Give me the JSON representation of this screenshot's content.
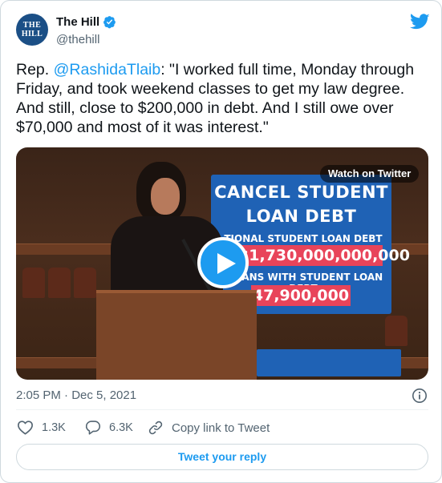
{
  "author": {
    "display_name": "The Hill",
    "handle": "@thehill",
    "verified": true,
    "avatar_text_line1": "THE",
    "avatar_text_line2": "HILL",
    "avatar_color": "#1b4f86"
  },
  "tweet": {
    "text_prefix": "Rep. ",
    "mention": "@RashidaTlaib",
    "text_body": ": \"I worked full time, Monday through Friday, and took weekend classes to get my law degree. And still, close to $200,000 in debt. And I still owe over $70,000 and most of it was interest.\"",
    "timestamp": "2:05 PM · Dec 5, 2021"
  },
  "media": {
    "watch_label": "Watch on Twitter",
    "sign_headline_1": "CANCEL STUDENT",
    "sign_headline_2": "LOAN DEBT",
    "sign_label_1": "TIONAL STUDENT LOAN DEBT",
    "sign_value_1": "$1,730,000,000,000",
    "sign_label_2": "RICANS WITH STUDENT LOAN DEBT",
    "sign_value_2": "47,900,000",
    "play_icon": "play-icon"
  },
  "actions": {
    "likes": "1.3K",
    "replies": "6.3K",
    "copy_link": "Copy link to Tweet",
    "reply_button": "Tweet your reply"
  },
  "colors": {
    "accent": "#1d9bf0",
    "text": "#0f1419",
    "secondary": "#536471",
    "border": "#cfd9de"
  }
}
